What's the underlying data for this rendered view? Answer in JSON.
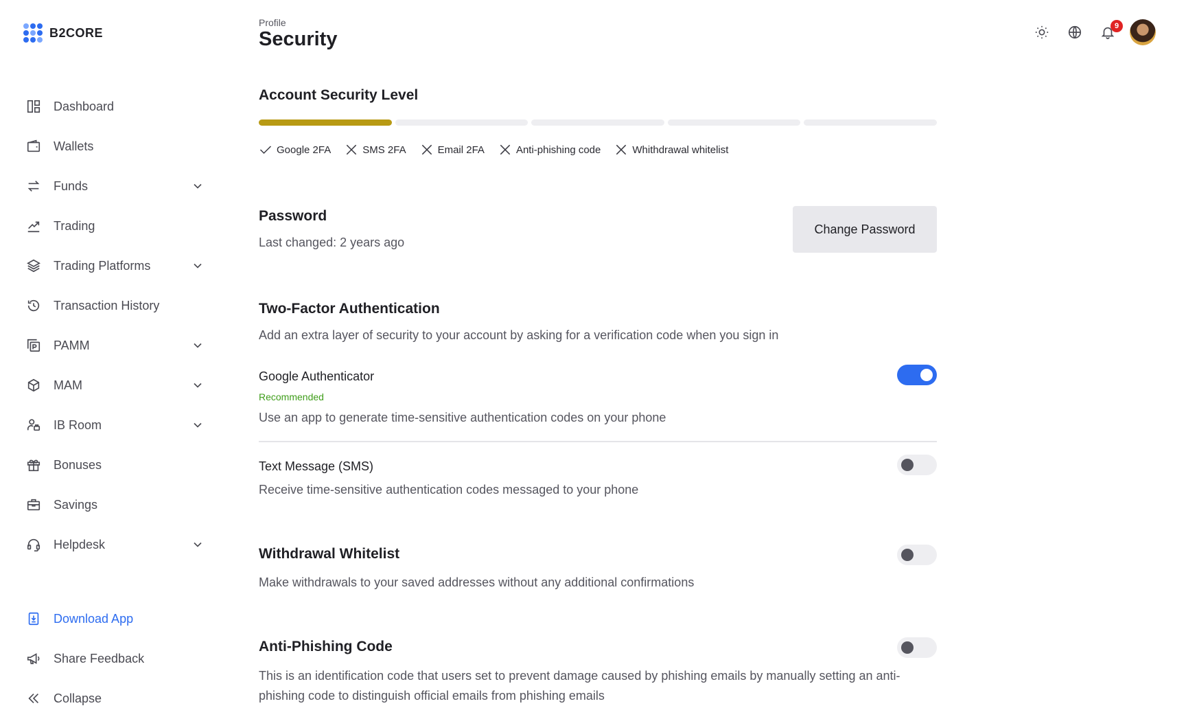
{
  "brand": {
    "name": "B2CORE"
  },
  "header": {
    "breadcrumb": "Profile",
    "title": "Security",
    "notifications_count": "9"
  },
  "sidebar": {
    "items": [
      {
        "label": "Dashboard",
        "icon": "dashboard-icon",
        "has_children": false
      },
      {
        "label": "Wallets",
        "icon": "wallet-icon",
        "has_children": false
      },
      {
        "label": "Funds",
        "icon": "transfer-arrows-icon",
        "has_children": true
      },
      {
        "label": "Trading",
        "icon": "trend-chart-icon",
        "has_children": false
      },
      {
        "label": "Trading Platforms",
        "icon": "layers-icon",
        "has_children": true
      },
      {
        "label": "Transaction History",
        "icon": "history-icon",
        "has_children": false
      },
      {
        "label": "PAMM",
        "icon": "pamm-icon",
        "has_children": true
      },
      {
        "label": "MAM",
        "icon": "cube-icon",
        "has_children": true
      },
      {
        "label": "IB Room",
        "icon": "ib-room-icon",
        "has_children": true
      },
      {
        "label": "Bonuses",
        "icon": "gift-icon",
        "has_children": false
      },
      {
        "label": "Savings",
        "icon": "briefcase-icon",
        "has_children": false
      },
      {
        "label": "Helpdesk",
        "icon": "headset-icon",
        "has_children": true
      }
    ],
    "bottom": [
      {
        "label": "Download App",
        "icon": "download-app-icon"
      },
      {
        "label": "Share Feedback",
        "icon": "megaphone-icon"
      },
      {
        "label": "Collapse",
        "icon": "double-chevron-left-icon"
      }
    ]
  },
  "security_level": {
    "title": "Account Security Level",
    "completed_steps": 1,
    "total_steps": 5,
    "accent_color": "#b89a14",
    "checks": [
      {
        "label": "Google 2FA",
        "done": true
      },
      {
        "label": "SMS 2FA",
        "done": false
      },
      {
        "label": "Email 2FA",
        "done": false
      },
      {
        "label": "Anti-phishing code",
        "done": false
      },
      {
        "label": "Whithdrawal whitelist",
        "done": false
      }
    ]
  },
  "password": {
    "title": "Password",
    "last_changed": "Last changed: 2 years ago",
    "button": "Change Password"
  },
  "two_factor": {
    "title": "Two-Factor Authentication",
    "subtitle": "Add an extra layer of security to your account by asking for a verification code when you sign in",
    "google": {
      "label": "Google Authenticator",
      "badge": "Recommended",
      "description": "Use an app to generate time-sensitive authentication codes on your phone",
      "enabled": true
    },
    "sms": {
      "label": "Text Message (SMS)",
      "description": "Receive time-sensitive authentication codes messaged to your phone",
      "enabled": false
    }
  },
  "withdrawal_whitelist": {
    "title": "Withdrawal Whitelist",
    "description": "Make withdrawals to your saved addresses without any additional confirmations",
    "enabled": false
  },
  "anti_phishing": {
    "title": "Anti-Phishing Code",
    "description": "This is an identification code that users set to prevent damage caused by phishing emails by manually setting an anti-phishing code to distinguish official emails from phishing emails",
    "enabled": false
  },
  "colors": {
    "primary": "#2d6cf0",
    "recommended": "#3f9d1a",
    "badge": "#e02424"
  }
}
